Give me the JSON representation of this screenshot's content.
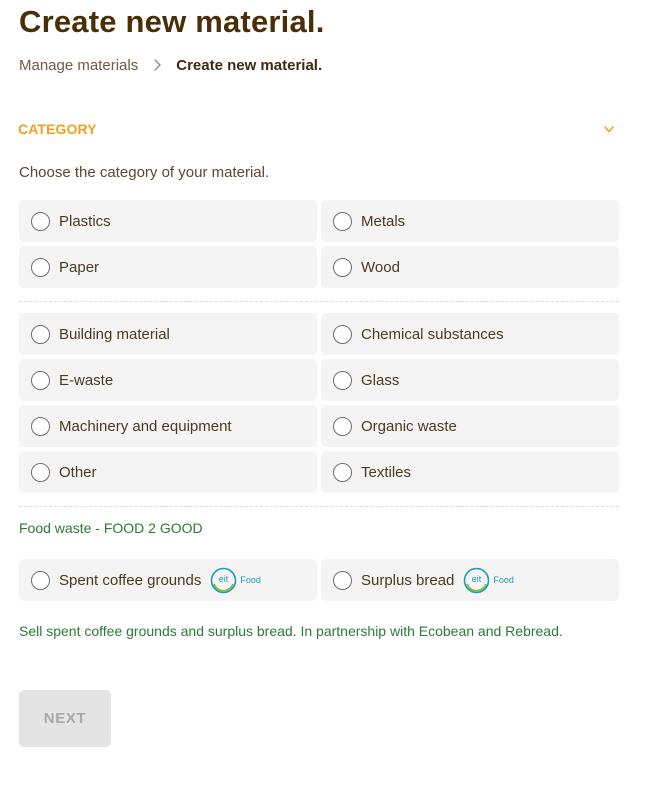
{
  "page": {
    "title": "Create new material."
  },
  "breadcrumb": {
    "parent": "Manage materials",
    "current": "Create new material."
  },
  "category": {
    "section_title": "CATEGORY",
    "instruction": "Choose the category of your material.",
    "group1": [
      "Plastics",
      "Metals",
      "Paper",
      "Wood"
    ],
    "group2": [
      "Building material",
      "Chemical substances",
      "E-waste",
      "Glass",
      "Machinery and equipment",
      "Organic waste",
      "Other",
      "Textiles"
    ],
    "food": {
      "heading": "Food waste - FOOD 2 GOOD",
      "options": [
        "Spent coffee grounds",
        "Surplus bread"
      ],
      "partner_logo_text": "eit",
      "partner_logo_suffix": "Food",
      "note": "Sell spent coffee grounds and surplus bread. In partnership with Ecobean and Rebread."
    }
  },
  "actions": {
    "next_label": "NEXT"
  },
  "colors": {
    "title": "#4a2e08",
    "accent_orange": "#f0a020",
    "food_green": "#2d7a35",
    "logo_blue": "#1e9bb5"
  },
  "icons": {
    "breadcrumb_separator": "chevron-right-icon",
    "section_toggle": "chevron-down-icon",
    "radio": "radio-unchecked-icon",
    "partner": "eit-food-logo-icon"
  }
}
